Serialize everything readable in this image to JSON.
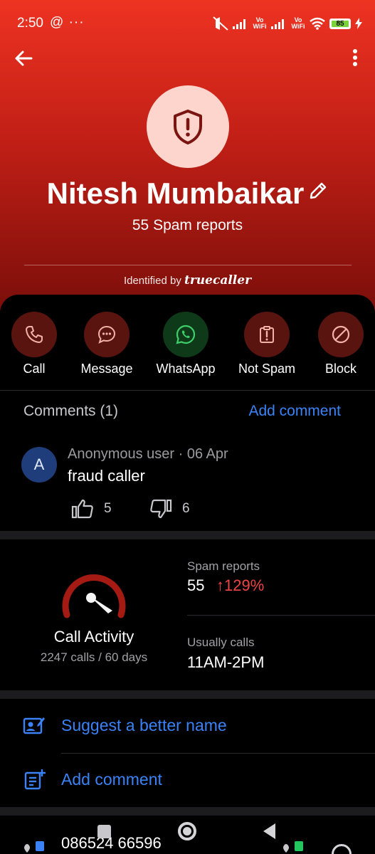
{
  "status_bar": {
    "time": "2:50",
    "extra_indicators": "@ ···",
    "vowifi_1": "Vo WiFi",
    "vowifi_2": "Vo WiFi",
    "battery": "85"
  },
  "profile": {
    "name": "Nitesh Mumbaikar",
    "spam_reports": "55 Spam reports",
    "identified_by": "Identified by",
    "brand": "truecaller"
  },
  "actions": [
    {
      "label": "Call",
      "icon": "phone-icon",
      "bg": "#5a1410",
      "color": "#f3b2a8"
    },
    {
      "label": "Message",
      "icon": "message-icon",
      "bg": "#5a1410",
      "color": "#f3b2a8"
    },
    {
      "label": "WhatsApp",
      "icon": "whatsapp-icon",
      "bg": "#0f3a1a",
      "color": "#3ecf6a"
    },
    {
      "label": "Not Spam",
      "icon": "not-spam-icon",
      "bg": "#5a1410",
      "color": "#f3b2a8"
    },
    {
      "label": "Block",
      "icon": "block-icon",
      "bg": "#5a1410",
      "color": "#f3b2a8"
    }
  ],
  "comments": {
    "title": "Comments (1)",
    "add_label": "Add comment",
    "items": [
      {
        "avatar_letter": "A",
        "meta": "Anonymous user · 06 Apr",
        "text": "fraud caller",
        "likes": "5",
        "dislikes": "6"
      }
    ]
  },
  "stats": {
    "call_activity_title": "Call Activity",
    "call_activity_sub": "2247 calls / 60 days",
    "spam_reports_label": "Spam reports",
    "spam_reports_value": "55",
    "spam_reports_change": "↑129%",
    "usually_calls_label": "Usually calls",
    "usually_calls_value": "11AM-2PM"
  },
  "links": {
    "suggest_name": "Suggest a better name",
    "add_comment": "Add comment"
  },
  "footer": {
    "phone_number": "086524 66596"
  },
  "colors": {
    "accent_blue": "#3b82f6",
    "spam_red": "#ef4444",
    "header_red": "#ee3322"
  }
}
